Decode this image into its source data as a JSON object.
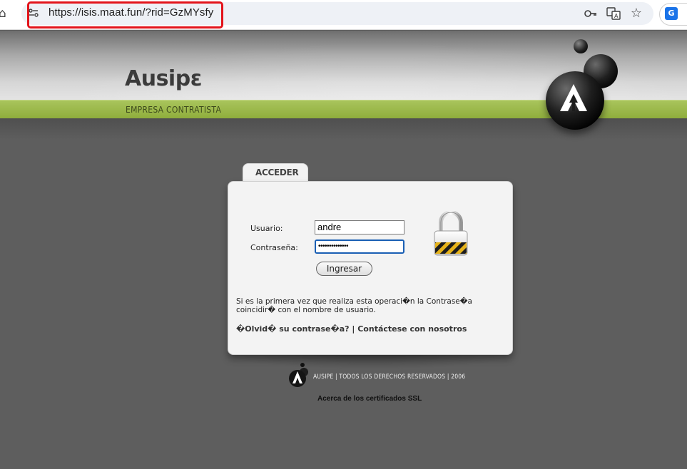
{
  "browser": {
    "url": "https://isis.maat.fun/?rid=GzMYsfy",
    "icons": [
      "home-icon",
      "site-settings-icon",
      "password-key-icon",
      "translate-icon",
      "bookmark-star-icon",
      "extension-icon"
    ],
    "highlight_color": "#e3141b"
  },
  "header": {
    "logo": "Ausipε",
    "tagline": "EMPRESA CONTRATISTA",
    "accent_color": "#8fae3c"
  },
  "login": {
    "tab_label": "ACCEDER",
    "username_label": "Usuario:",
    "username_value": "andre",
    "password_label": "Contraseña:",
    "password_value": "••••••••••••••",
    "submit_label": "Ingresar",
    "info_text": "Si es la primera vez que realiza esta operaci�n la Contrase�a coincidir� con el nombre de usuario.",
    "forgot_link": "�Olvid� su contrase�a?",
    "separator": " | ",
    "contact_link": "Contáctese con nosotros"
  },
  "footer": {
    "copyright": "AUSIPE | TODOS LOS DERECHOS RESERVADOS | 2006",
    "ssl_link": "Acerca de los certificados SSL"
  }
}
